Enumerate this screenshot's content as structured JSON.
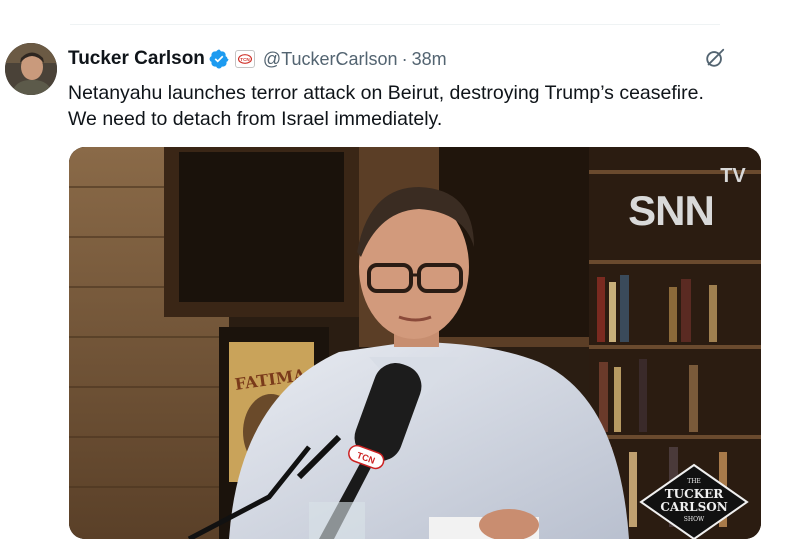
{
  "tweet": {
    "author_name": "Tucker Carlson",
    "handle": "@TuckerCarlson",
    "separator": "·",
    "timestamp": "38m",
    "affiliate_badge": "TCN",
    "text_lines": [
      "Netanyahu launches terror attack on Beirut, destroying Trump’s ceasefire.",
      "We need to detach from Israel immediately."
    ]
  },
  "media": {
    "watermark_tv": "TV",
    "watermark_brand": "SNN",
    "wall_poster_text": "FATIMA",
    "mic_brand": "TCN",
    "show_logo_top": "THE",
    "show_logo_line1": "TUCKER",
    "show_logo_line2": "CARLSON",
    "show_logo_bottom": "SHOW"
  },
  "colors": {
    "verified_blue": "#1d9bf0",
    "secondary_text": "#536471",
    "primary_text": "#0f1419"
  },
  "icons": {
    "verified": "verified-badge-icon",
    "grok": "grok-icon"
  }
}
